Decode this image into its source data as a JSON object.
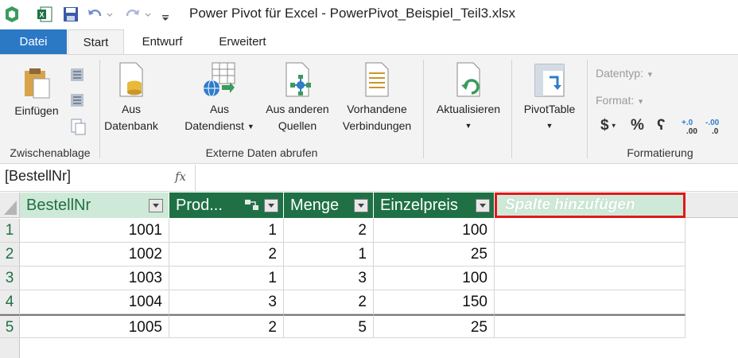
{
  "window": {
    "title": "Power Pivot für Excel - PowerPivot_Beispiel_Teil3.xlsx"
  },
  "tabs": [
    "Datei",
    "Start",
    "Entwurf",
    "Erweitert"
  ],
  "ribbon": {
    "clipboard": {
      "paste_label": "Einfügen",
      "group_label": "Zwischenablage"
    },
    "external": {
      "from_db_line1": "Aus",
      "from_db_line2": "Datenbank",
      "from_service_line1": "Aus",
      "from_service_line2": "Datendienst",
      "other_line1": "Aus anderen",
      "other_line2": "Quellen",
      "existing_line1": "Vorhandene",
      "existing_line2": "Verbindungen",
      "group_label": "Externe Daten abrufen"
    },
    "refresh_label": "Aktualisieren",
    "pivot_label": "PivotTable",
    "formatting": {
      "datatype_label": "Datentyp:",
      "format_label": "Format:",
      "currency_symbol": "$",
      "percent_symbol": "%",
      "thousands_symbol": "ʕ",
      "inc_decimal": "+.0 .00",
      "dec_decimal": "-.00 .0",
      "group_label": "Formatierung"
    }
  },
  "formula_bar": {
    "name_box": "[BestellNr]",
    "fx": "fx"
  },
  "table": {
    "columns": [
      "BestellNr",
      "Prod...",
      "Menge",
      "Einzelpreis"
    ],
    "add_column": "Spalte hinzufügen",
    "rows": [
      {
        "num": "1",
        "values": [
          "1001",
          "1",
          "2",
          "100"
        ]
      },
      {
        "num": "2",
        "values": [
          "1002",
          "2",
          "1",
          "25"
        ]
      },
      {
        "num": "3",
        "values": [
          "1003",
          "1",
          "3",
          "100"
        ]
      },
      {
        "num": "4",
        "values": [
          "1004",
          "3",
          "2",
          "150"
        ]
      },
      {
        "num": "5",
        "values": [
          "1005",
          "2",
          "5",
          "25"
        ]
      }
    ]
  },
  "colors": {
    "accent_green": "#1f7145",
    "file_tab_blue": "#2b78c5",
    "highlight_red": "#e0191b"
  }
}
